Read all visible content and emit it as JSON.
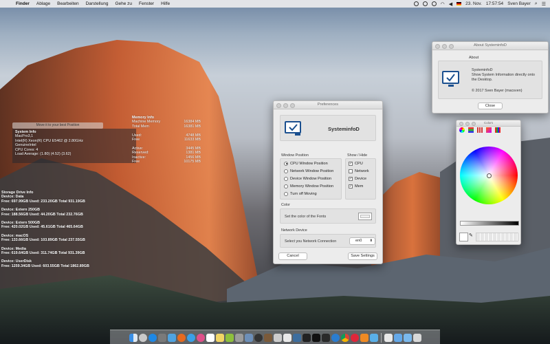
{
  "menubar": {
    "app": "Finder",
    "items": [
      "Ablage",
      "Bearbeiten",
      "Darstellung",
      "Gehe zu",
      "Fenster",
      "Hilfe"
    ],
    "date": "23. Nov.",
    "time": "17:57:54",
    "user": "Sven Bayer"
  },
  "overlay": {
    "position_button": "Move it to your best Position",
    "system": {
      "title": "System Info",
      "lines": [
        "MacPro3,1",
        "Intel(R) Xeon(R) CPU          E5462  @ 2.80GHz",
        "GenuineIntel",
        "CPU Cores: 4",
        "Load Average:   (1.80) (4.52) (3.62)"
      ]
    },
    "memory": {
      "title": "Memory Info",
      "rows": [
        {
          "k": "Machine Memory",
          "v": "16384 MB"
        },
        {
          "k": "Total Mem",
          "v": "16381 MB"
        },
        {
          "k": "",
          "v": ""
        },
        {
          "k": "Used:",
          "v": "4748 MB"
        },
        {
          "k": "Free",
          "v": "11633 MB"
        },
        {
          "k": "",
          "v": ""
        },
        {
          "k": "Active:",
          "v": "3445 MB"
        },
        {
          "k": "Reserved:",
          "v": "1381 MB"
        },
        {
          "k": "Inactive:",
          "v": "1456 MB"
        },
        {
          "k": "Free",
          "v": "10175 MB"
        }
      ]
    },
    "storage": {
      "title": "Storage Drive Info",
      "devices": [
        {
          "name": "Device: Data",
          "info": "Free: 697.99GB Used: 233.20GB Total 931.19GB"
        },
        {
          "name": "Device: Extern 250GB",
          "info": "Free: 188.56GB Used: 44.20GB Total 232.76GB"
        },
        {
          "name": "Device: Extern 500GB",
          "info": "Free: 420.02GB Used: 45.61GB Total 465.64GB"
        },
        {
          "name": "Device: macOS",
          "info": "Free: 133.66GB Used: 103.89GB Total 237.55GB"
        },
        {
          "name": "Device: Media",
          "info": "Free: 619.64GB Used: 311.74GB Total 931.39GB"
        },
        {
          "name": "Device: UserDisk",
          "info": "Free: 1259.34GB Used: 603.55GB Total 1862.89GB"
        }
      ]
    }
  },
  "prefs": {
    "title": "Preferences",
    "app_name": "SysteminfoD",
    "window_position_label": "Window Position",
    "positions": [
      {
        "label": "CPU Window Position",
        "selected": true
      },
      {
        "label": "Network Window Position",
        "selected": false
      },
      {
        "label": "Device Window Position",
        "selected": false
      },
      {
        "label": "Memory Window Position",
        "selected": false
      },
      {
        "label": "Turn off Moving",
        "selected": false
      }
    ],
    "show_hide_label": "Show / Hide",
    "show_items": [
      {
        "label": "CPU",
        "checked": true
      },
      {
        "label": "Network",
        "checked": false
      },
      {
        "label": "Device",
        "checked": true
      },
      {
        "label": "Mem",
        "checked": true
      }
    ],
    "color_label": "Color",
    "color_text": "Set the color of the Fonts",
    "network_label": "Network Device",
    "network_text": "Select you Network Connection",
    "network_value": "en0",
    "cancel": "Cancel",
    "save": "Save Settings"
  },
  "about": {
    "title": "About SysteminfoD",
    "section": "About",
    "app_name": "SysteminfoD",
    "desc": "Show System Information directly onto the Desktop.",
    "copyright": "© 2017 Sven Bayer (macsven)",
    "close": "Close"
  },
  "colors_panel": {
    "title": "Colors"
  },
  "accent": "#1a4f8f"
}
